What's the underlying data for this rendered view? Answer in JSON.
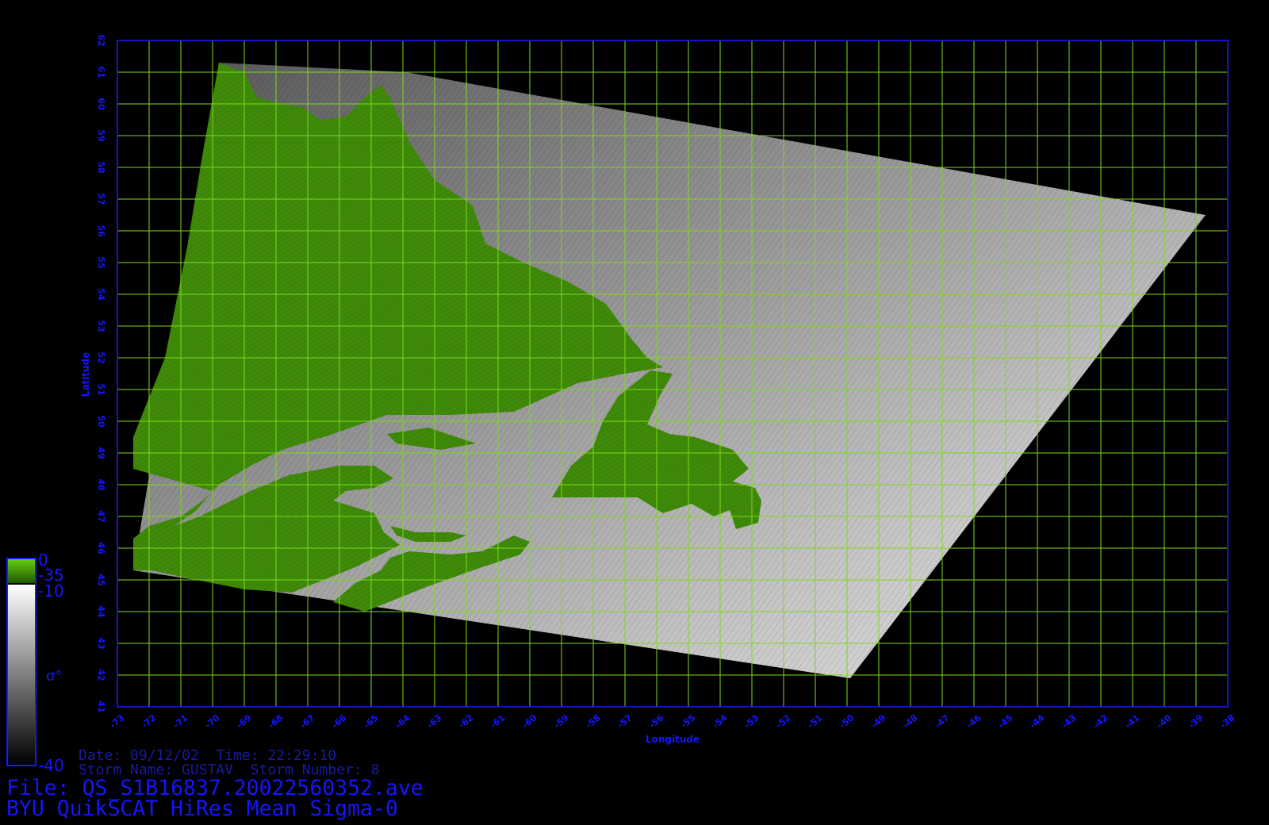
{
  "map": {
    "lon_range": [
      -73,
      -38
    ],
    "lat_range": [
      41,
      62
    ],
    "lon_ticks": [
      "-73",
      "-72",
      "-71",
      "-70",
      "-69",
      "-68",
      "-67",
      "-66",
      "-65",
      "-64",
      "-63",
      "-62",
      "-61",
      "-60",
      "-59",
      "-58",
      "-57",
      "-56",
      "-55",
      "-54",
      "-53",
      "-52",
      "-51",
      "-50",
      "-49",
      "-48",
      "-47",
      "-46",
      "-45",
      "-44",
      "-43",
      "-42",
      "-41",
      "-40",
      "-39",
      "-38"
    ],
    "lat_ticks": [
      "41",
      "42",
      "43",
      "44",
      "45",
      "46",
      "47",
      "48",
      "49",
      "50",
      "51",
      "52",
      "53",
      "54",
      "55",
      "56",
      "57",
      "58",
      "59",
      "60",
      "61",
      "62"
    ],
    "xlabel": "Longitude",
    "ylabel": "Latitude",
    "grid": true,
    "colors": {
      "grid": "#7fd81c",
      "frame": "#1a1aff",
      "land": "#3f8a08",
      "labels": "#1515ff"
    },
    "swath_corners_lonlat": [
      [
        -69.8,
        61.3
      ],
      [
        -63.9,
        61.0
      ],
      [
        -38.7,
        56.5
      ],
      [
        -49.9,
        41.9
      ],
      [
        -72.5,
        45.3
      ]
    ]
  },
  "colorbar": {
    "land_top": "0",
    "land_bottom": "-35",
    "ocean_top": "-10",
    "ocean_bottom": "-40",
    "symbol": "σ°"
  },
  "info": {
    "date_line": "Date: 09/12/02  Time: 22:29:10",
    "storm_line": "Storm Name: GUSTAV  Storm Number: 8"
  },
  "title": {
    "file_line": "File: QS_S1B16837.20022560352.ave",
    "product_line": "BYU QuikSCAT HiRes Mean Sigma-0"
  }
}
